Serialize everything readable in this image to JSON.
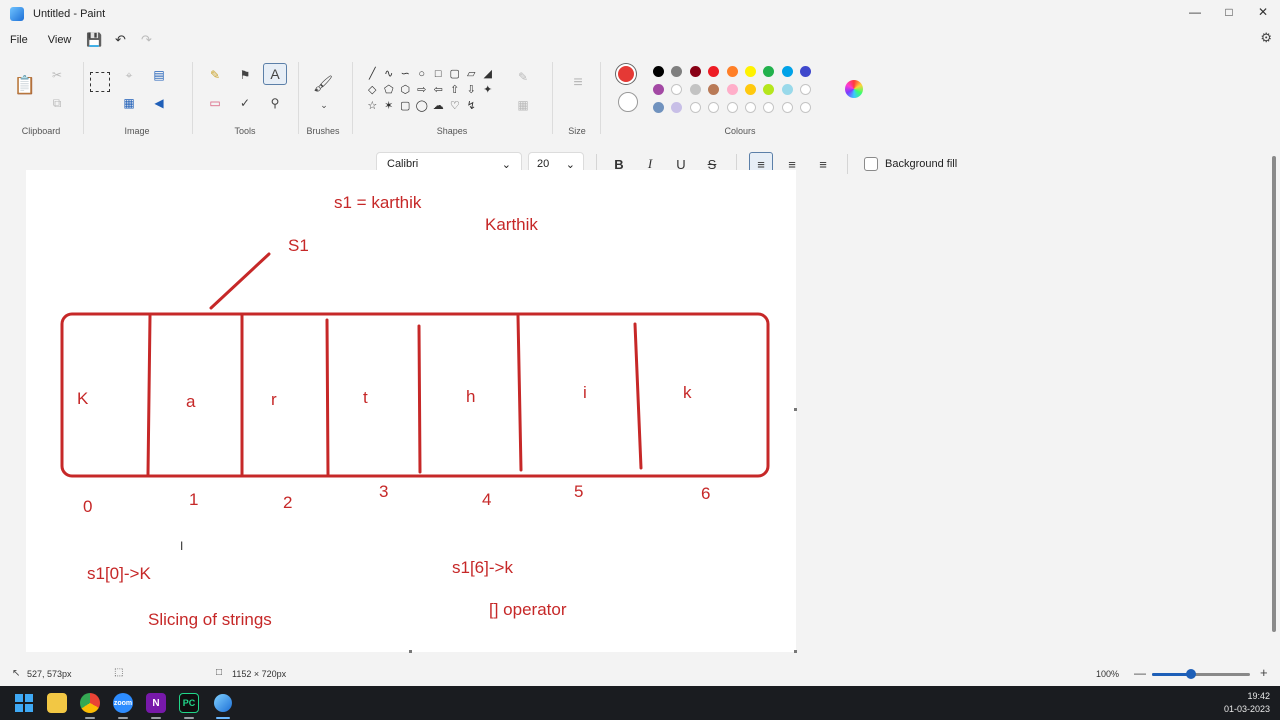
{
  "window": {
    "title": "Untitled - Paint",
    "controls": [
      "minimize-icon",
      "maximize-icon",
      "close-icon"
    ]
  },
  "menu": {
    "items": [
      "File",
      "View"
    ],
    "icons": [
      "save-icon",
      "undo-icon",
      "redo-icon"
    ],
    "settings_icon": "settings-icon"
  },
  "ribbon": {
    "groups": {
      "clipboard": "Clipboard",
      "image": "Image",
      "tools": "Tools",
      "brushes": "Brushes",
      "shapes": "Shapes",
      "size": "Size",
      "colours": "Colours"
    },
    "active_tool": "text",
    "primary_color": "#e53935",
    "secondary_color": "#ffffff",
    "palette_row1": [
      "#000000",
      "#7f7f7f",
      "#880015",
      "#ed1c24",
      "#ff7f27",
      "#fff200",
      "#22b14c",
      "#00a2e8",
      "#3f48cc"
    ],
    "palette_row2": [
      "#a349a4",
      "#ffffff",
      "#c3c3c3",
      "#b97a57",
      "#ffaec9",
      "#ffc90e",
      "#b5e61d",
      "#99d9ea"
    ],
    "palette_row3": [
      "#7092be",
      "#c8bfe7"
    ]
  },
  "text_toolbar": {
    "font": "Calibri",
    "size": "20",
    "bold": "B",
    "italic": "I",
    "underline": "U",
    "strike": "S",
    "background_fill_label": "Background fill",
    "background_fill_checked": false,
    "alignment": "left"
  },
  "canvas": {
    "stroke_color": "#c62828",
    "texts": {
      "assignment": "s1 = karthik",
      "value": "Karthik",
      "var_label": "S1",
      "cells": [
        "K",
        "a",
        "r",
        "t",
        "h",
        "i",
        "k"
      ],
      "indices": [
        "0",
        "1",
        "2",
        "3",
        "4",
        "5",
        "6"
      ],
      "example1": "s1[0]->K",
      "example2": "s1[6]->k",
      "slicing": "Slicing of strings",
      "operator": "[] operator"
    }
  },
  "status": {
    "cursor_pos": "527, 573px",
    "canvas_size": "1152 × 720px",
    "zoom": "100%",
    "zoom_level": 0.4
  },
  "taskbar": {
    "apps": [
      "windows-start",
      "file-explorer",
      "chrome",
      "zoom",
      "onenote",
      "pycharm",
      "paint"
    ],
    "time": "19:42",
    "date": "01-03-2023"
  }
}
